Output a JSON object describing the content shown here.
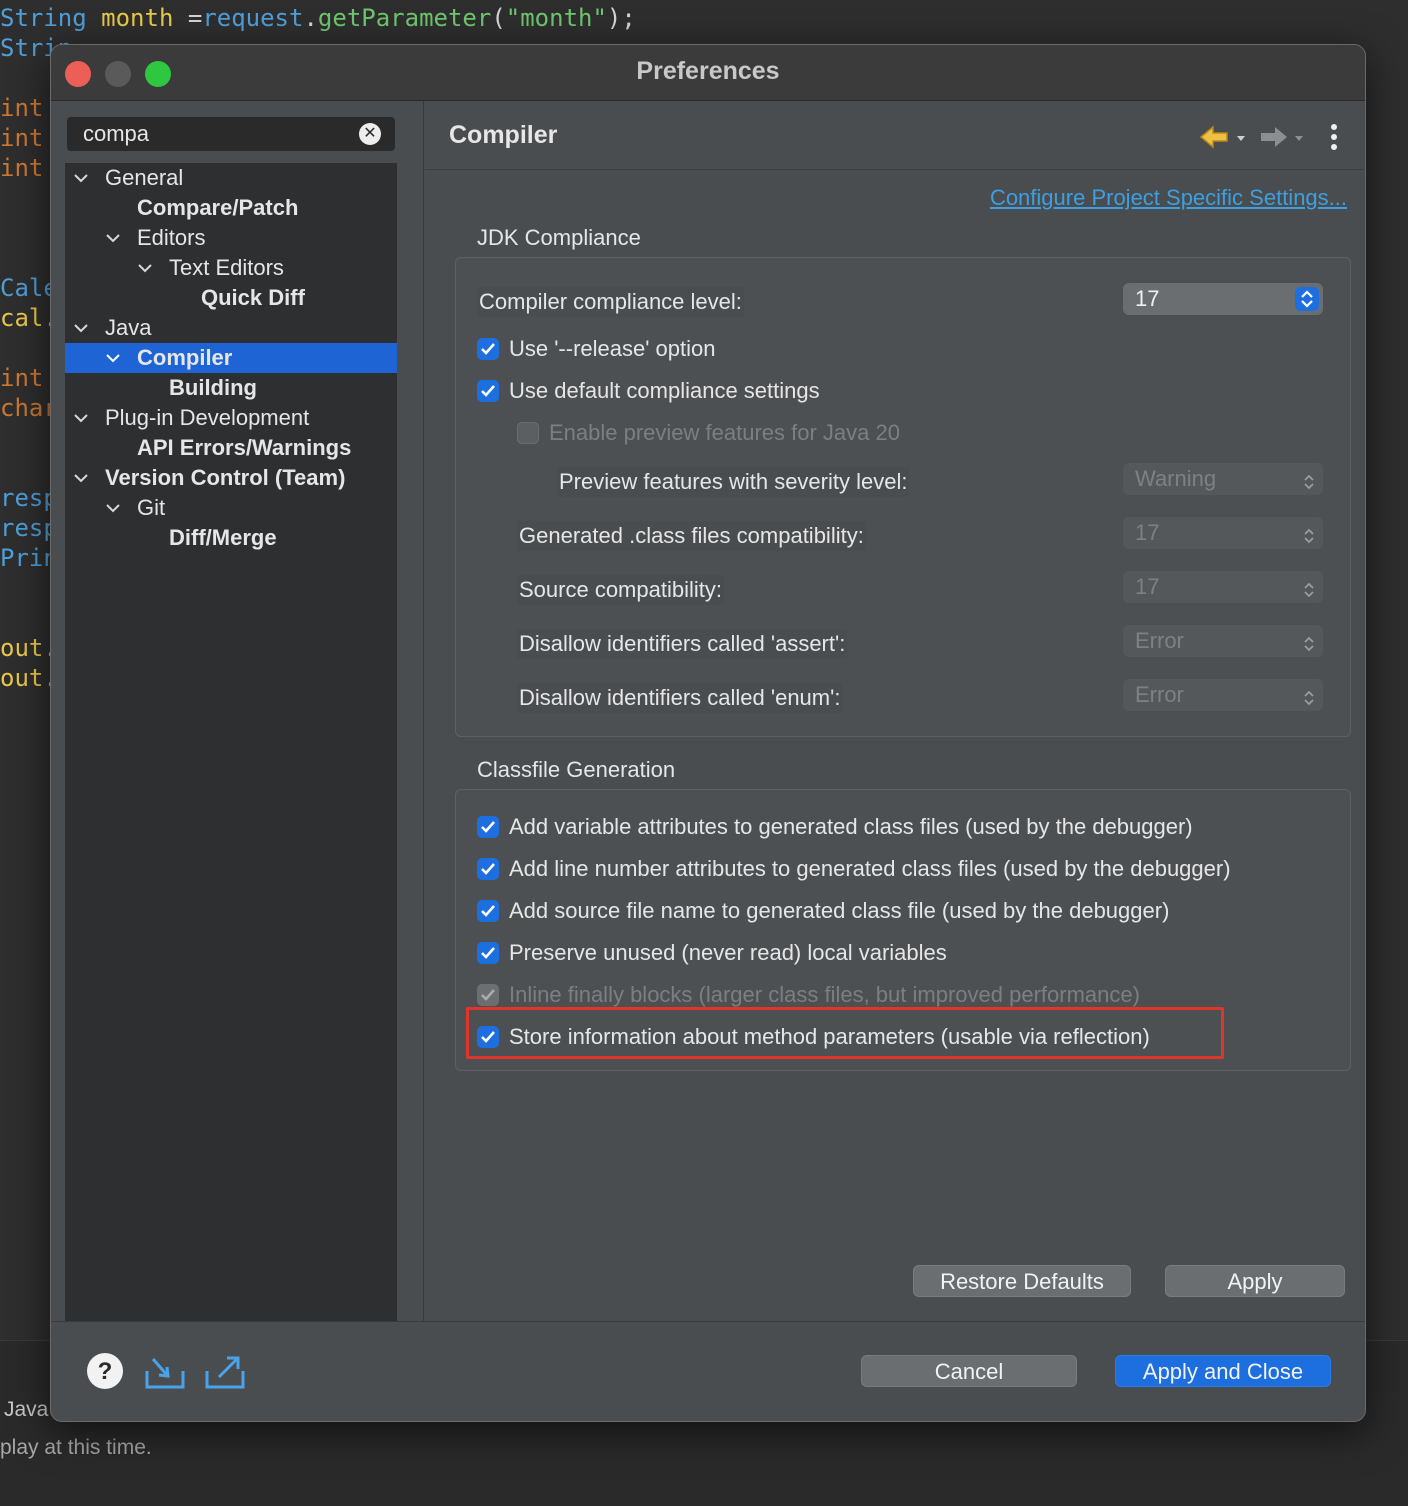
{
  "editor": {
    "lines": [
      {
        "segments": [
          [
            "type",
            "String "
          ],
          [
            "ident",
            "month "
          ],
          [
            "plain",
            "="
          ],
          [
            "type",
            "request"
          ],
          [
            "plain",
            "."
          ],
          [
            "str",
            "getParameter"
          ],
          [
            "plain",
            "("
          ],
          [
            "str",
            "\"month\""
          ],
          [
            "plain",
            ");"
          ]
        ]
      },
      {
        "segments": [
          [
            "type",
            "Strin"
          ]
        ]
      },
      {
        "segments": [
          [
            "int",
            "int"
          ]
        ]
      },
      {
        "segments": [
          [
            "int",
            "int"
          ]
        ]
      },
      {
        "segments": [
          [
            "int",
            "int"
          ]
        ]
      },
      {
        "segments": [
          [
            "type",
            "Cale"
          ]
        ]
      },
      {
        "segments": [
          [
            "ident",
            "cal."
          ]
        ]
      },
      {
        "segments": [
          [
            "int",
            "int"
          ]
        ]
      },
      {
        "segments": [
          [
            "int",
            "char"
          ]
        ]
      },
      {
        "segments": [
          [
            "type",
            "resp"
          ]
        ]
      },
      {
        "segments": [
          [
            "type",
            "resp"
          ]
        ]
      },
      {
        "segments": [
          [
            "type",
            "Prin"
          ]
        ]
      },
      {
        "segments": [
          [
            "ident",
            "out."
          ]
        ]
      },
      {
        "segments": [
          [
            "ident",
            "out."
          ]
        ]
      }
    ],
    "bottom_tab": "Java",
    "bottom_message": "play at this time."
  },
  "dialog": {
    "title": "Preferences",
    "search": {
      "value": "compa"
    },
    "tree": [
      {
        "label": "General",
        "level": 0,
        "expanded": true,
        "bold": false
      },
      {
        "label": "Compare/Patch",
        "level": 1,
        "leaf": true,
        "bold": true
      },
      {
        "label": "Editors",
        "level": 1,
        "expanded": true,
        "bold": false
      },
      {
        "label": "Text Editors",
        "level": 2,
        "expanded": true,
        "bold": false
      },
      {
        "label": "Quick Diff",
        "level": 3,
        "leaf": true,
        "bold": true
      },
      {
        "label": "Java",
        "level": 0,
        "expanded": true,
        "bold": false
      },
      {
        "label": "Compiler",
        "level": 1,
        "expanded": true,
        "bold": true,
        "selected": true
      },
      {
        "label": "Building",
        "level": 2,
        "leaf": true,
        "bold": true
      },
      {
        "label": "Plug-in Development",
        "level": 0,
        "expanded": true,
        "bold": false
      },
      {
        "label": "API Errors/Warnings",
        "level": 1,
        "leaf": true,
        "bold": true
      },
      {
        "label": "Version Control (Team)",
        "level": 0,
        "expanded": true,
        "bold": true
      },
      {
        "label": "Git",
        "level": 1,
        "expanded": true,
        "bold": false
      },
      {
        "label": "Diff/Merge",
        "level": 2,
        "leaf": true,
        "bold": true
      }
    ],
    "page": {
      "title": "Compiler",
      "project_link": "Configure Project Specific Settings...",
      "jdk": {
        "group_title": "JDK Compliance",
        "compliance_label": "Compiler compliance level:",
        "compliance_value": "17",
        "use_release": {
          "label": "Use '--release' option",
          "checked": true
        },
        "use_default": {
          "label": "Use default compliance settings",
          "checked": true
        },
        "enable_preview": {
          "label": "Enable preview features for Java 20",
          "checked": false,
          "enabled": false
        },
        "preview_severity": {
          "label": "Preview features with severity level:",
          "value": "Warning"
        },
        "generated_compat": {
          "label": "Generated .class files compatibility:",
          "value": "17"
        },
        "source_compat": {
          "label": "Source compatibility:",
          "value": "17"
        },
        "assert_ident": {
          "label": "Disallow identifiers called 'assert':",
          "value": "Error"
        },
        "enum_ident": {
          "label": "Disallow identifiers called 'enum':",
          "value": "Error"
        }
      },
      "classfile": {
        "group_title": "Classfile Generation",
        "options": [
          {
            "label": "Add variable attributes to generated class files (used by the debugger)",
            "checked": true,
            "enabled": true
          },
          {
            "label": "Add line number attributes to generated class files (used by the debugger)",
            "checked": true,
            "enabled": true
          },
          {
            "label": "Add source file name to generated class file (used by the debugger)",
            "checked": true,
            "enabled": true
          },
          {
            "label": "Preserve unused (never read) local variables",
            "checked": true,
            "enabled": true
          },
          {
            "label": "Inline finally blocks (larger class files, but improved performance)",
            "checked": true,
            "enabled": false
          },
          {
            "label": "Store information about method parameters (usable via reflection)",
            "checked": true,
            "enabled": true
          }
        ]
      },
      "restore_defaults": "Restore Defaults",
      "apply": "Apply"
    },
    "footer": {
      "cancel": "Cancel",
      "apply_and_close": "Apply and Close"
    },
    "colors": {
      "accent": "#1d6fe0",
      "highlight": "#e0352b",
      "link": "#3d9fe0"
    }
  }
}
